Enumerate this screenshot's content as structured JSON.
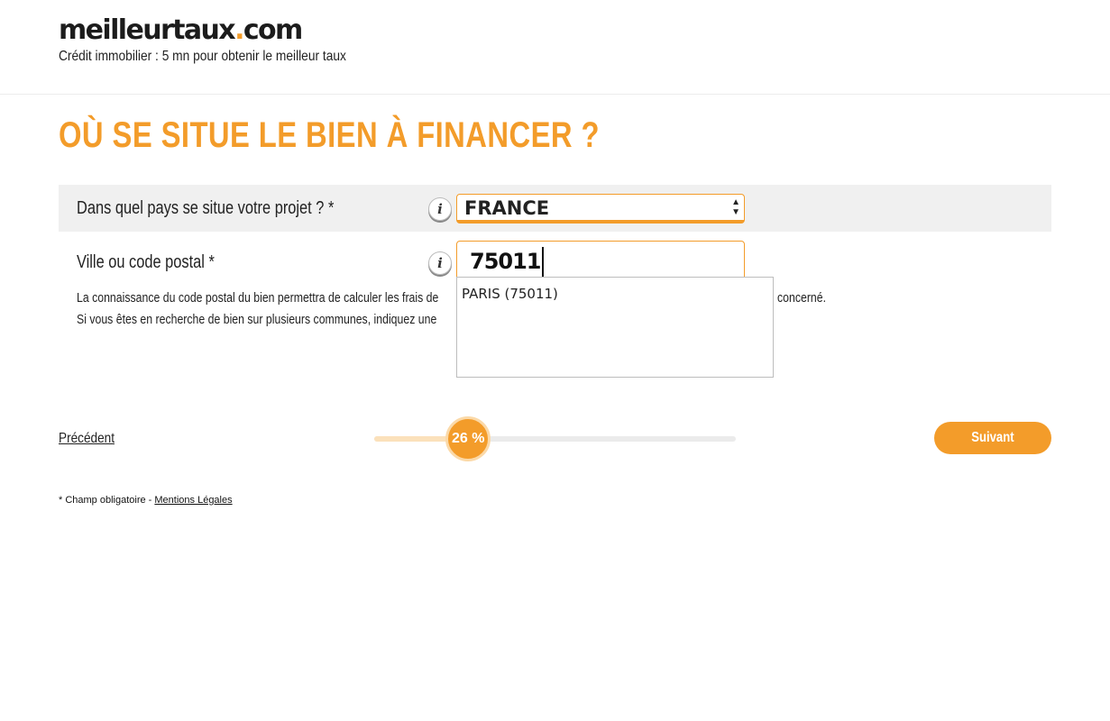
{
  "header": {
    "logo_main": "meilleurtaux",
    "logo_dot": ".",
    "logo_tld": "com",
    "tagline": "Crédit immobilier : 5 mn pour obtenir le meilleur taux"
  },
  "page_title": "OÙ SE SITUE LE BIEN À FINANCER ?",
  "form": {
    "country": {
      "label": "Dans quel pays se situe votre projet ? *",
      "info_icon_glyph": "i",
      "selected_value": "FRANCE",
      "arrows": [
        "▲",
        "▼"
      ]
    },
    "postal": {
      "label": "Ville ou code postal *",
      "info_icon_glyph": "i",
      "value": "75011",
      "suggestions": [
        "PARIS (75011)"
      ]
    },
    "help_line_1_left": "La connaissance du code postal du bien permettra de calculer les frais de",
    "help_line_1_right": "concerné.",
    "help_line_2_left": "Si vous êtes en recherche de bien sur plusieurs communes, indiquez une"
  },
  "navigation": {
    "previous_label": "Précédent",
    "next_label": "Suivant",
    "progress_percent": 26,
    "progress_text": "26 %"
  },
  "footer": {
    "required_note": "* Champ obligatoire - ",
    "legal_link": "Mentions Légales"
  },
  "colors": {
    "accent": "#f39c2a",
    "accent_light": "#fbe1bb",
    "row_background": "#f0f0f0"
  }
}
